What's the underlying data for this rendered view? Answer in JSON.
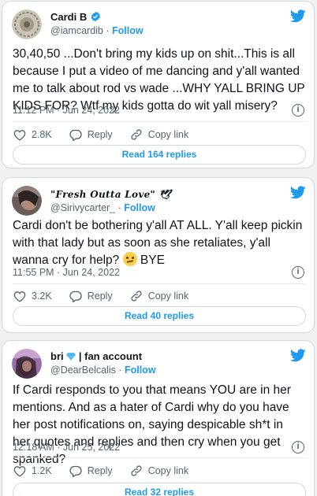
{
  "tweets": [
    {
      "name": "Cardi B",
      "verified": true,
      "handle": "@iamcardib",
      "follow": "Follow",
      "text": "30,40,50 ...Don't bring my kids up on shit...This is all because I put a video of me dancing and y'all wanted me to talk about rod vs wade ...WHY YALL BRING UP KIDS FOR? Wtf my kids gotta do wit yall misery?",
      "time": "11:12 PM · Jun 24, 2022",
      "likes": "2.8K",
      "reply": "Reply",
      "copy": "Copy link",
      "read": "Read 164 replies"
    },
    {
      "name": "\"Fresh Outta Love\" 🕊",
      "handle": "@Sirivycarter_",
      "follow": "Follow",
      "text": "Cardi don't be bothering y'all AT ALL. Y'all keep pickin with that lady but as soon as she retaliates, y'all wanna cry for help?",
      "text_tail": " BYE",
      "time": "11:55 PM · Jun 24, 2022",
      "likes": "3.2K",
      "reply": "Reply",
      "copy": "Copy link",
      "read": "Read 40 replies"
    },
    {
      "name_pre": "bri",
      "name_post": "| fan account",
      "handle": "@DearBelcalis",
      "follow": "Follow",
      "text": "If Cardi responds to you that means YOU are in her mentions. And as a hater of Cardi why do you have her post notifications on, saying despicable sh*t in her quotes and replies and then cry when you get spanked?",
      "time": "12:18 AM · Jun 25, 2022",
      "likes": "1.2K",
      "reply": "Reply",
      "copy": "Copy link",
      "read": "Read 32 replies"
    }
  ],
  "colors": {
    "accent": "#1d9bf0",
    "muted": "#536471",
    "verified": "#1d9bf0"
  },
  "icons": [
    "twitter-bird-icon",
    "heart-icon",
    "reply-icon",
    "link-icon",
    "info-icon",
    "verified-icon",
    "diamond-icon",
    "dove-icon",
    "sad-face-emoji"
  ]
}
